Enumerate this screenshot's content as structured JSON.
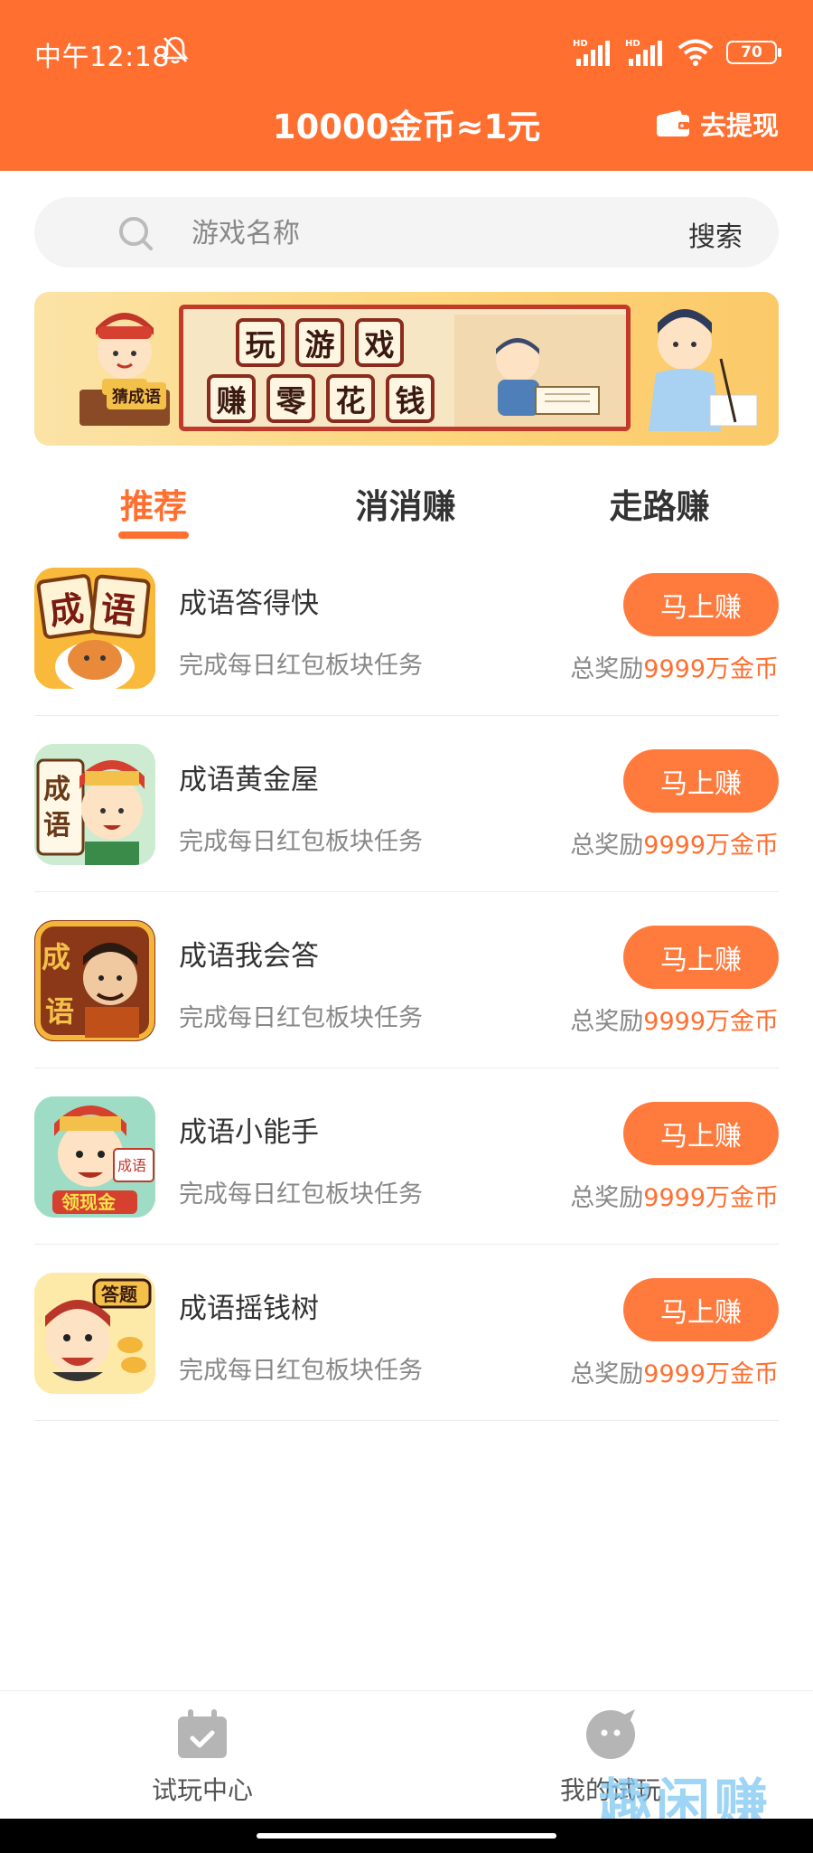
{
  "status_bar": {
    "time": "中午12:18",
    "battery": "70",
    "signal_label": "HD"
  },
  "header": {
    "title": "10000金币≈1元",
    "withdraw_label": "去提现"
  },
  "search": {
    "placeholder": "游戏名称",
    "value": "",
    "button_label": "搜索"
  },
  "banner": {
    "badge_text": "猜成语",
    "row1": [
      "玩",
      "游",
      "戏"
    ],
    "row2": [
      "赚",
      "零",
      "花",
      "钱"
    ]
  },
  "tabs": [
    {
      "label": "推荐",
      "active": true
    },
    {
      "label": "消消赚",
      "active": false
    },
    {
      "label": "走路赚",
      "active": false
    }
  ],
  "games": [
    {
      "name": "成语答得快",
      "desc": "完成每日红包板块任务",
      "button": "马上赚",
      "reward_prefix": "总奖励",
      "reward_amount": "9999万金币",
      "icon": "idiom-shiba-icon",
      "icon_text": "成语"
    },
    {
      "name": "成语黄金屋",
      "desc": "完成每日红包板块任务",
      "button": "马上赚",
      "reward_prefix": "总奖励",
      "reward_amount": "9999万金币",
      "icon": "idiom-official-icon",
      "icon_text": "成语"
    },
    {
      "name": "成语我会答",
      "desc": "完成每日红包板块任务",
      "button": "马上赚",
      "reward_prefix": "总奖励",
      "reward_amount": "9999万金币",
      "icon": "idiom-warrior-icon",
      "icon_text": "成语"
    },
    {
      "name": "成语小能手",
      "desc": "完成每日红包板块任务",
      "button": "马上赚",
      "reward_prefix": "总奖励",
      "reward_amount": "9999万金币",
      "icon": "idiom-fortune-god-icon",
      "icon_text": "领现金"
    },
    {
      "name": "成语摇钱树",
      "desc": "完成每日红包板块任务",
      "button": "马上赚",
      "reward_prefix": "总奖励",
      "reward_amount": "9999万金币",
      "icon": "idiom-money-tree-icon",
      "icon_text": "答题"
    }
  ],
  "bottom_nav": [
    {
      "label": "试玩中心",
      "icon": "calendar-check-icon"
    },
    {
      "label": "我的试玩",
      "icon": "chat-face-icon"
    }
  ],
  "watermark": "趣闲赚",
  "colors": {
    "brand": "#ff6f30",
    "button": "#ff7b3d"
  }
}
